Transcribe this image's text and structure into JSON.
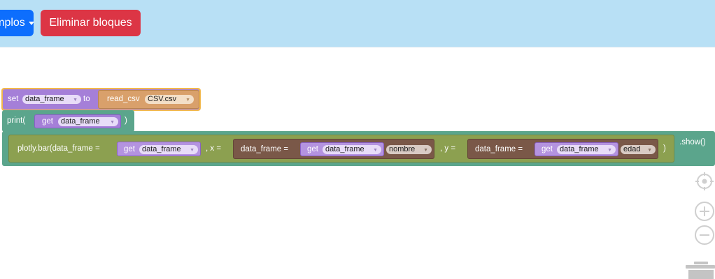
{
  "toolbar": {
    "examples_label": "Ejemplos",
    "delete_label": "Eliminar bloques"
  },
  "blocks": {
    "set": {
      "keyword": "set",
      "variable": "data_frame",
      "to": "to",
      "call": "read_csv",
      "file": "CSV.csv"
    },
    "print": {
      "open": "print(",
      "get": "get",
      "variable": "data_frame",
      "close": ")"
    },
    "plot": {
      "call": "plotly.bar(data_frame =",
      "get1": "get",
      "var1": "data_frame",
      "x_sep": ", x =",
      "x_expr": "data_frame =",
      "x_get": "get",
      "x_var": "data_frame",
      "x_col": "nombre",
      "y_sep": ", y =",
      "y_expr": "data_frame =",
      "y_get": "get",
      "y_var": "data_frame",
      "y_col": "edad",
      "close": ")",
      "show": ".show()"
    }
  },
  "icons": [
    "dropdown-caret-icon",
    "target-icon",
    "zoom-in-icon",
    "zoom-out-icon",
    "trash-icon"
  ],
  "colors": {
    "topbar": "#b8e0f5",
    "examples_button": "#0d6efd",
    "delete_button": "#dc3545",
    "variable_block": "#a57fd8",
    "csv_block": "#d4a373",
    "print_block": "#5ba58c",
    "plot_block": "#5ba58c",
    "inner_plot": "#8ca050",
    "dict_block": "#7a5848"
  }
}
